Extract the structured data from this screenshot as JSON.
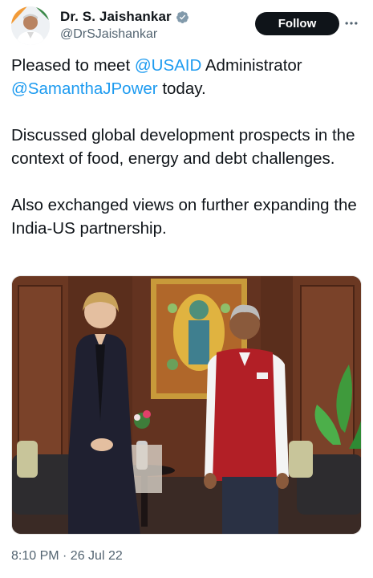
{
  "author": {
    "display_name": "Dr. S. Jaishankar",
    "handle": "@DrSJaishankar",
    "verified_icon": "verified-badge-icon",
    "avatar_icon": "profile-photo"
  },
  "actions": {
    "follow_label": "Follow",
    "more_icon": "more-options-icon"
  },
  "tweet": {
    "line1_pre": "Pleased to meet ",
    "mention1": "@USAID",
    "line1_post": " Administrator",
    "mention2": "@SamanthaJPower",
    "line2_post": " today.",
    "paragraph2": "Discussed global development prospects in the context of food, energy and debt challenges.",
    "paragraph3": "Also exchanged views on further expanding the India-US partnership."
  },
  "media": {
    "type": "photo"
  },
  "meta": {
    "timestamp": "8:10 PM · 26 Jul 22"
  },
  "colors": {
    "accent": "#1d9bf0",
    "text": "#0f1419",
    "secondary": "#536471",
    "button_bg": "#0f1419"
  }
}
